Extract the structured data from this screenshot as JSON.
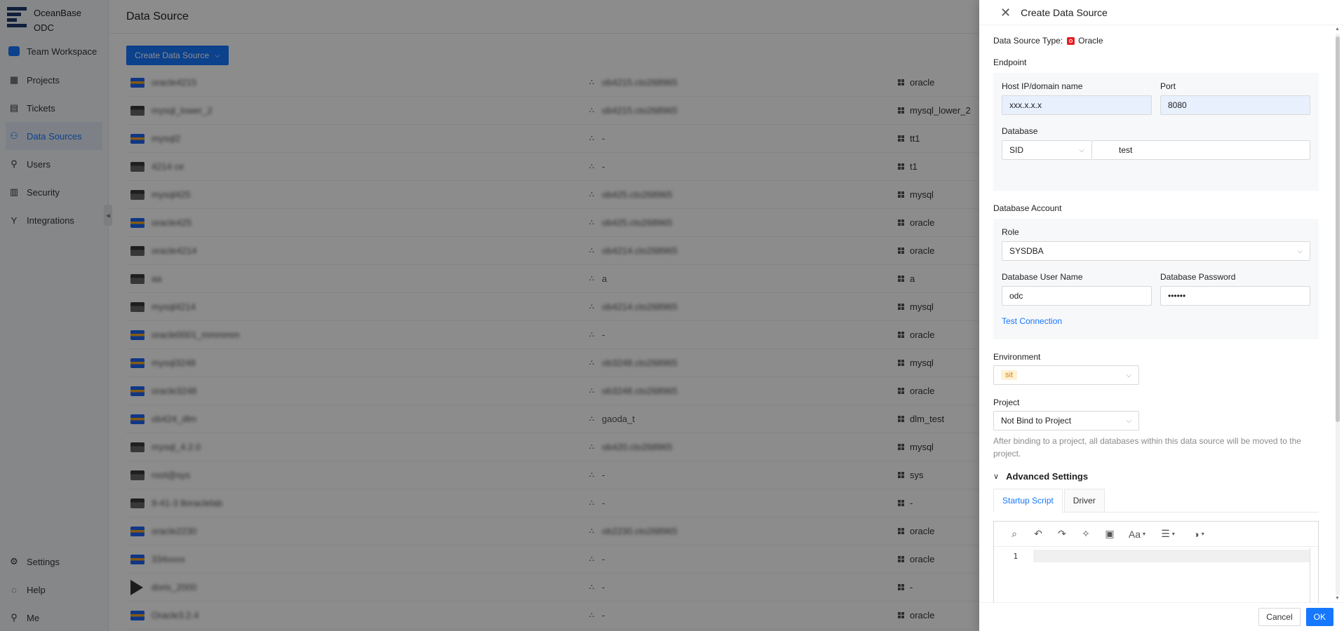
{
  "sidebar": {
    "brand": [
      "OceanBase",
      "ODC"
    ],
    "team_workspace": "Team Workspace",
    "items": [
      {
        "label": "Projects",
        "icon": "projects-icon"
      },
      {
        "label": "Tickets",
        "icon": "tickets-icon"
      },
      {
        "label": "Data Sources",
        "icon": "data-sources-icon",
        "active": true
      },
      {
        "label": "Users",
        "icon": "users-icon"
      },
      {
        "label": "Security",
        "icon": "security-icon"
      },
      {
        "label": "Integrations",
        "icon": "integrations-icon"
      }
    ],
    "bottom": [
      {
        "label": "Settings",
        "icon": "gear-icon"
      },
      {
        "label": "Help",
        "icon": "help-icon"
      },
      {
        "label": "Me",
        "icon": "user-icon"
      }
    ]
  },
  "main": {
    "title": "Data Source",
    "create_button": "Create Data Source",
    "rows": [
      {
        "name": "oracle4215",
        "host": "ob4215.cto268965",
        "tenant": "oracle",
        "kind": "blue"
      },
      {
        "name": "mysql_lower_2",
        "host": "ob4215.cto268965",
        "tenant": "mysql_lower_2",
        "kind": "dark"
      },
      {
        "name": "mysql2",
        "host": "-",
        "tenant": "tt1",
        "kind": "blue"
      },
      {
        "name": "4214 ce",
        "host": "-",
        "tenant": "t1",
        "kind": "dark"
      },
      {
        "name": "mysql425",
        "host": "ob425.cto268965",
        "tenant": "mysql",
        "kind": "dark"
      },
      {
        "name": "oracle425",
        "host": "ob425.cto268965",
        "tenant": "oracle",
        "kind": "blue"
      },
      {
        "name": "oracle4214",
        "host": "ob4214.cto268965",
        "tenant": "oracle",
        "kind": "dark"
      },
      {
        "name": "aa",
        "host": "a",
        "tenant": "a",
        "kind": "dark"
      },
      {
        "name": "mysql4214",
        "host": "ob4214.cto268965",
        "tenant": "mysql",
        "kind": "dark"
      },
      {
        "name": "oracle0001_mmmmm",
        "host": "-",
        "tenant": "oracle",
        "kind": "blue"
      },
      {
        "name": "mysql3248",
        "host": "ob3248.cto268965",
        "tenant": "mysql",
        "kind": "blue"
      },
      {
        "name": "oracle3248",
        "host": "ob3248.cto268965",
        "tenant": "oracle",
        "kind": "blue"
      },
      {
        "name": "ob424_dlm",
        "host": "gaoda_t",
        "tenant": "dlm_test",
        "kind": "blue"
      },
      {
        "name": "mysql_4.2.0",
        "host": "ob420.cto268965",
        "tenant": "mysql",
        "kind": "dark"
      },
      {
        "name": "root@sys",
        "host": "-",
        "tenant": "sys",
        "kind": "dark"
      },
      {
        "name": "9-41-3 8oraclelab",
        "host": "-",
        "tenant": "-",
        "kind": "dark"
      },
      {
        "name": "oracle2230",
        "host": "ob2230.cto268965",
        "tenant": "oracle",
        "kind": "blue"
      },
      {
        "name": "334xxxx",
        "host": "-",
        "tenant": "oracle",
        "kind": "blue"
      },
      {
        "name": "doris_2000",
        "host": "-",
        "tenant": "-",
        "kind": "play"
      },
      {
        "name": "Oracle3.2.4",
        "host": "-",
        "tenant": "oracle",
        "kind": "blue"
      }
    ]
  },
  "drawer": {
    "title": "Create Data Source",
    "type_label": "Data Source Type:",
    "type_value": "Oracle",
    "endpoint_title": "Endpoint",
    "host_label": "Host IP/domain name",
    "host_value": "xxx.x.x.x",
    "port_label": "Port",
    "port_value": "8080",
    "database_label": "Database",
    "db_mode": "SID",
    "db_value": "test",
    "account_title": "Database Account",
    "role_label": "Role",
    "role_value": "SYSDBA",
    "user_label": "Database User Name",
    "user_value": "odc",
    "password_label": "Database Password",
    "password_value": "••••••",
    "test_connection": "Test Connection",
    "env_label": "Environment",
    "env_value": "sit",
    "project_label": "Project",
    "project_value": "Not Bind to Project",
    "project_hint": "After binding to a project, all databases within this data source will be moved to the project.",
    "advanced_title": "Advanced Settings",
    "tabs": [
      "Startup Script",
      "Driver"
    ],
    "editor_line_number": "1",
    "cancel": "Cancel",
    "ok": "OK"
  },
  "colors": {
    "primary": "#1677ff",
    "env_tag_bg": "#fdf1d6",
    "env_tag_text": "#d48806",
    "oracle_red": "#e31e24"
  }
}
